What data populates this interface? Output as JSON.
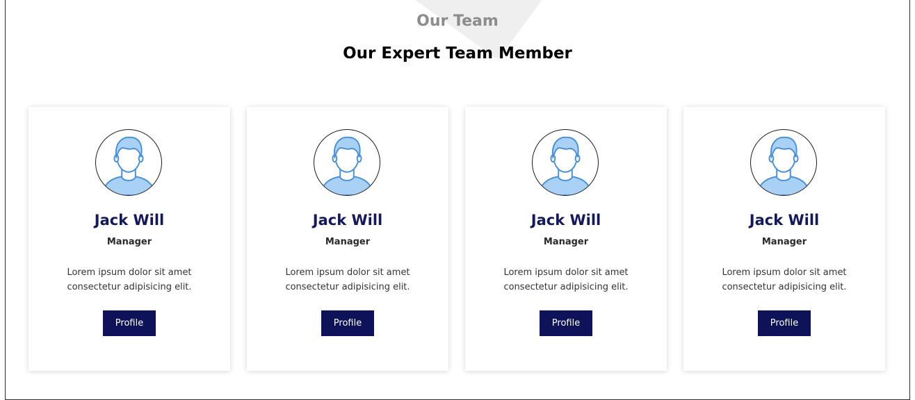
{
  "section": {
    "eyebrow": "Our Team",
    "title": "Our Expert Team Member"
  },
  "members": [
    {
      "name": "Jack Will",
      "role": "Manager",
      "bio": "Lorem ipsum dolor sit amet consectetur adipisicing elit.",
      "button": "Profile",
      "icon": "user-avatar-icon"
    },
    {
      "name": "Jack Will",
      "role": "Manager",
      "bio": "Lorem ipsum dolor sit amet consectetur adipisicing elit.",
      "button": "Profile",
      "icon": "user-avatar-icon"
    },
    {
      "name": "Jack Will",
      "role": "Manager",
      "bio": "Lorem ipsum dolor sit amet consectetur adipisicing elit.",
      "button": "Profile",
      "icon": "user-avatar-icon"
    },
    {
      "name": "Jack Will",
      "role": "Manager",
      "bio": "Lorem ipsum dolor sit amet consectetur adipisicing elit.",
      "button": "Profile",
      "icon": "user-avatar-icon"
    }
  ],
  "colors": {
    "accent": "#0d1259",
    "name": "#14195c",
    "eyebrow": "#8c8c8c",
    "avatar_fill": "#a9d1f5",
    "avatar_stroke": "#4a90d9"
  }
}
